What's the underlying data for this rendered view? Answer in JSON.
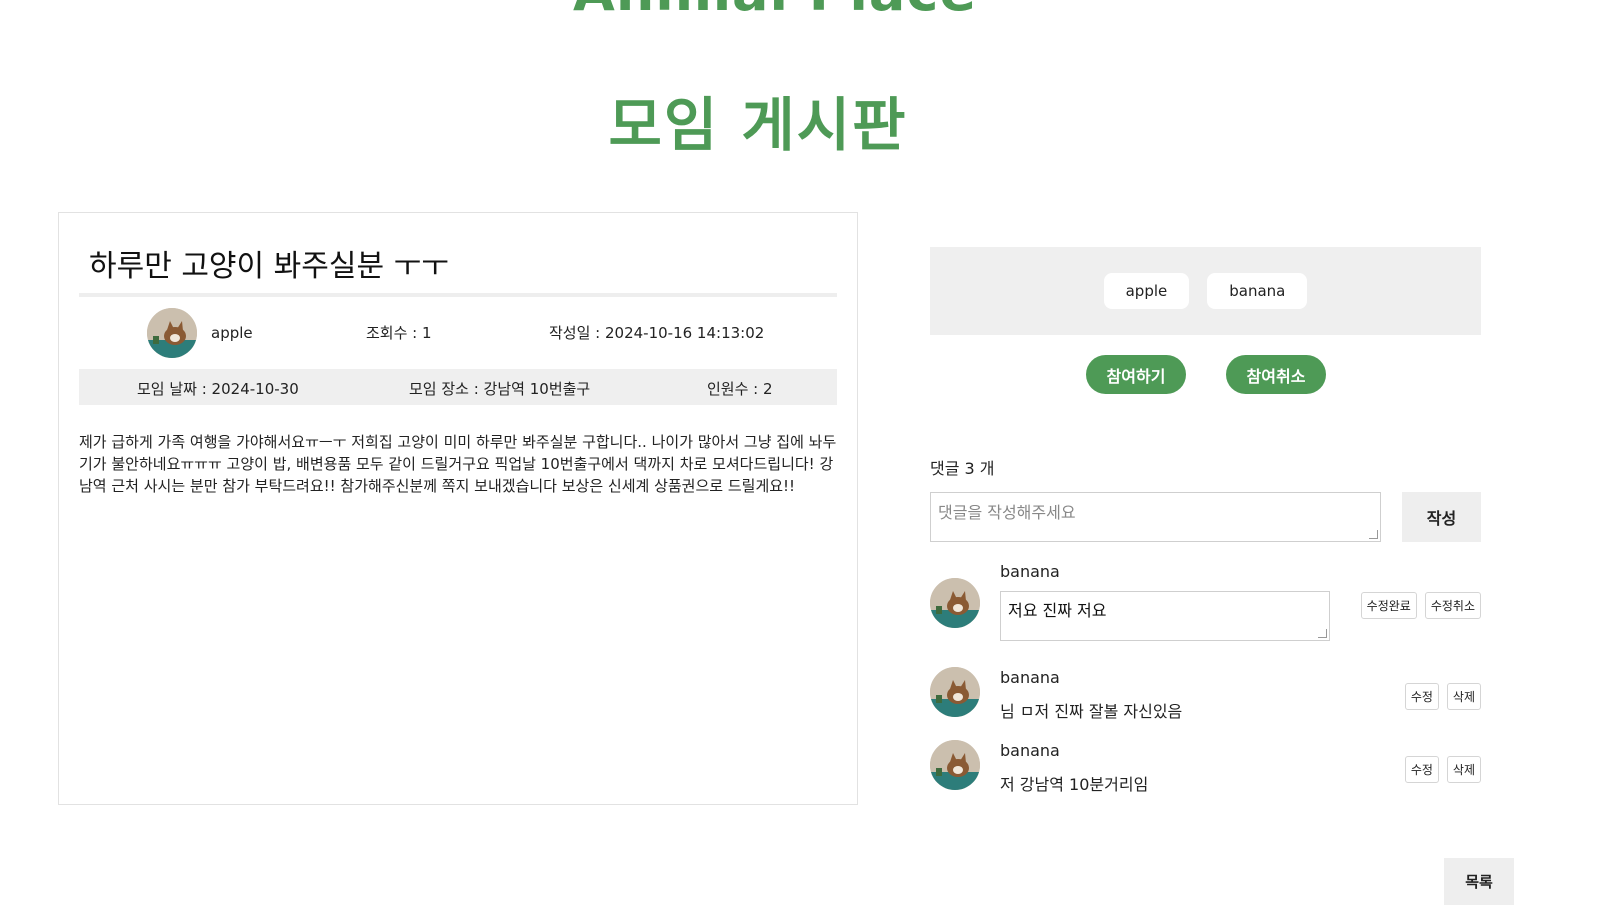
{
  "site": {
    "title": "Animal Place"
  },
  "page": {
    "title": "모임 게시판"
  },
  "post": {
    "title": "하루만 고양이 봐주실분 ㅜㅜ",
    "author": "apple",
    "views": "조회수 : 1",
    "created": "작성일 : 2024-10-16 14:13:02",
    "meeting_date": "모임 날짜 : 2024-10-30",
    "meeting_place": "모임 장소 : 강남역 10번출구",
    "headcount": "인원수 : 2",
    "body": "제가 급하게 가족 여행을 가야해서요ㅠㅡㅜ 저희집 고양이 미미 하루만 봐주실분 구합니다.. 나이가 많아서 그냥 집에 놔두기가 불안하네요ㅠㅠㅠ 고양이 밥, 배변용품 모두 같이 드릴거구요 픽업날 10번출구에서 댁까지 차로 모셔다드립니다! 강남역 근처 사시는 분만 참가 부탁드려요!! 참가해주신분께 쪽지 보내겠습니다 보상은 신세계 상품권으로 드릴게요!!"
  },
  "participants": [
    "apple",
    "banana"
  ],
  "actions": {
    "join": "참여하기",
    "cancel": "참여취소"
  },
  "comments_section": {
    "count_label": "댓글 3 개",
    "placeholder": "댓글을 작성해주세요",
    "write": "작성"
  },
  "comments": [
    {
      "author": "banana",
      "text": "저요 진짜 저요",
      "editing": true,
      "btn1": "수정완료",
      "btn2": "수정취소"
    },
    {
      "author": "banana",
      "text": "님 ㅁ저 진짜 잘볼 자신있음",
      "editing": false,
      "btn1": "수정",
      "btn2": "삭제"
    },
    {
      "author": "banana",
      "text": "저 강남역 10분거리임",
      "editing": false,
      "btn1": "수정",
      "btn2": "삭제"
    }
  ],
  "footer": {
    "list": "목록"
  },
  "icons": {
    "avatar": "cat-avatar-icon"
  },
  "colors": {
    "accent": "#4e9a56"
  }
}
